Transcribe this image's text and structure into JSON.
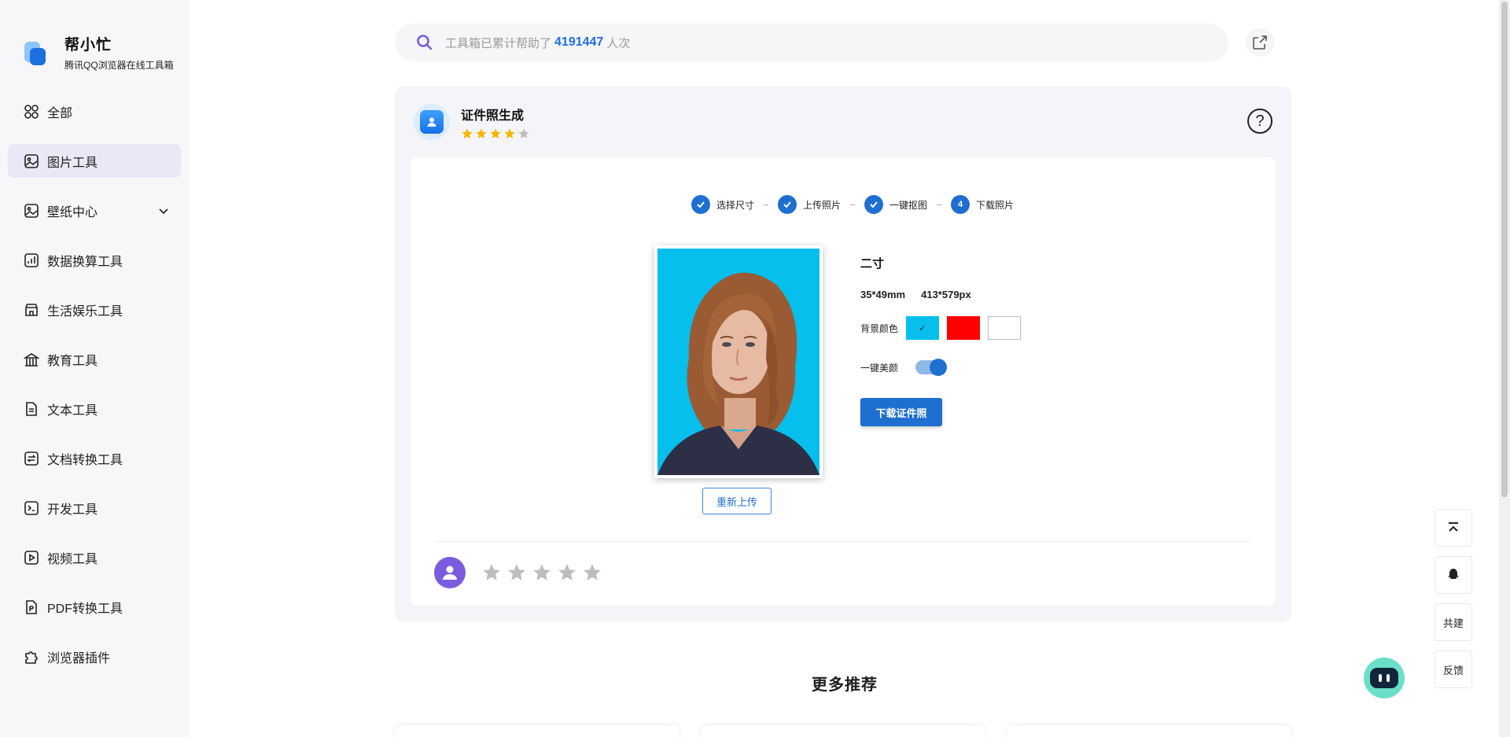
{
  "brand": {
    "name": "帮小忙",
    "subtitle": "腾讯QQ浏览器在线工具箱"
  },
  "sidebar": {
    "items": [
      {
        "label": "全部",
        "icon": "grid-icon"
      },
      {
        "label": "图片工具",
        "icon": "image-icon",
        "active": true
      },
      {
        "label": "壁纸中心",
        "icon": "wallpaper-icon",
        "expandable": true
      },
      {
        "label": "数据换算工具",
        "icon": "chart-icon"
      },
      {
        "label": "生活娱乐工具",
        "icon": "store-icon"
      },
      {
        "label": "教育工具",
        "icon": "education-icon"
      },
      {
        "label": "文本工具",
        "icon": "document-icon"
      },
      {
        "label": "文档转换工具",
        "icon": "convert-icon"
      },
      {
        "label": "开发工具",
        "icon": "terminal-icon"
      },
      {
        "label": "视频工具",
        "icon": "video-icon"
      },
      {
        "label": "PDF转换工具",
        "icon": "pdf-icon"
      },
      {
        "label": "浏览器插件",
        "icon": "puzzle-icon"
      }
    ]
  },
  "search": {
    "prefix": "工具箱已累计帮助了",
    "count": "4191447",
    "suffix": "人次"
  },
  "tool": {
    "title": "证件照生成",
    "rating_stars": 4,
    "steps": [
      {
        "label": "选择尺寸",
        "done": true
      },
      {
        "label": "上传照片",
        "done": true
      },
      {
        "label": "一键抠图",
        "done": true
      },
      {
        "label": "下载照片",
        "number": "4",
        "done": false
      }
    ],
    "size_name": "二寸",
    "size_mm": "35*49mm",
    "size_px": "413*579px",
    "bg_label": "背景颜色",
    "bg_colors": [
      {
        "color": "#06bfec",
        "selected": true,
        "mark": "✓"
      },
      {
        "color": "#ff0000",
        "selected": false,
        "mark": ""
      },
      {
        "color": "#ffffff",
        "selected": false,
        "mark": ""
      }
    ],
    "beauty_label": "一键美颜",
    "beauty_on": true,
    "download_label": "下载证件照",
    "reupload_label": "重新上传"
  },
  "feedback": {
    "stars": 5
  },
  "more": {
    "title": "更多推荐"
  },
  "float": {
    "cobuild_label": "共建",
    "feedback_label": "反馈"
  },
  "colors": {
    "primary": "#1f6fd0",
    "star_gold": "#f7b500",
    "star_gray": "#bdbdbd",
    "photo_bg": "#06bfec"
  }
}
